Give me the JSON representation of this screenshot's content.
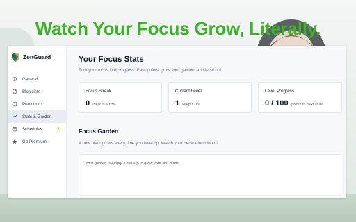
{
  "promo": {
    "headline": "Watch Your Focus Grow, Literally.",
    "headline_color": "#3ab426"
  },
  "app": {
    "brand": {
      "name": "ZenGuard",
      "logo_icon": "shield-logo-icon"
    },
    "sidebar": {
      "items": [
        {
          "label": "General",
          "icon": "gear-icon",
          "active": false
        },
        {
          "label": "Blocklists",
          "icon": "block-icon",
          "active": false
        },
        {
          "label": "Pomodoro",
          "icon": "timer-icon",
          "active": false
        },
        {
          "label": "Stats & Garden",
          "icon": "trend-chart-icon",
          "active": true
        },
        {
          "label": "Schedules",
          "icon": "calendar-icon",
          "active": false,
          "badge": "★"
        },
        {
          "label": "Go Premium",
          "icon": "star-icon",
          "active": false
        }
      ]
    },
    "main": {
      "title": "Your Focus Stats",
      "subtitle": "Turn your focus into progress. Earn points, grow your garden, and level up!",
      "cards": [
        {
          "label": "Focus Streak",
          "value": "0",
          "suffix": "days in a row"
        },
        {
          "label": "Current Level",
          "value": "1",
          "suffix": "keep it up!"
        },
        {
          "label": "Level Progress",
          "value": "0 / 100",
          "suffix": "points to next level"
        }
      ],
      "garden": {
        "title": "Focus Garden",
        "subtitle": "A new plant grows every time you level up. Watch your dedication bloom!",
        "empty_text": "Your garden is empty. Level up to grow your first plant!"
      }
    },
    "colors": {
      "active_bg": "#e8ecf4",
      "badge_star": "#f5b301"
    }
  }
}
